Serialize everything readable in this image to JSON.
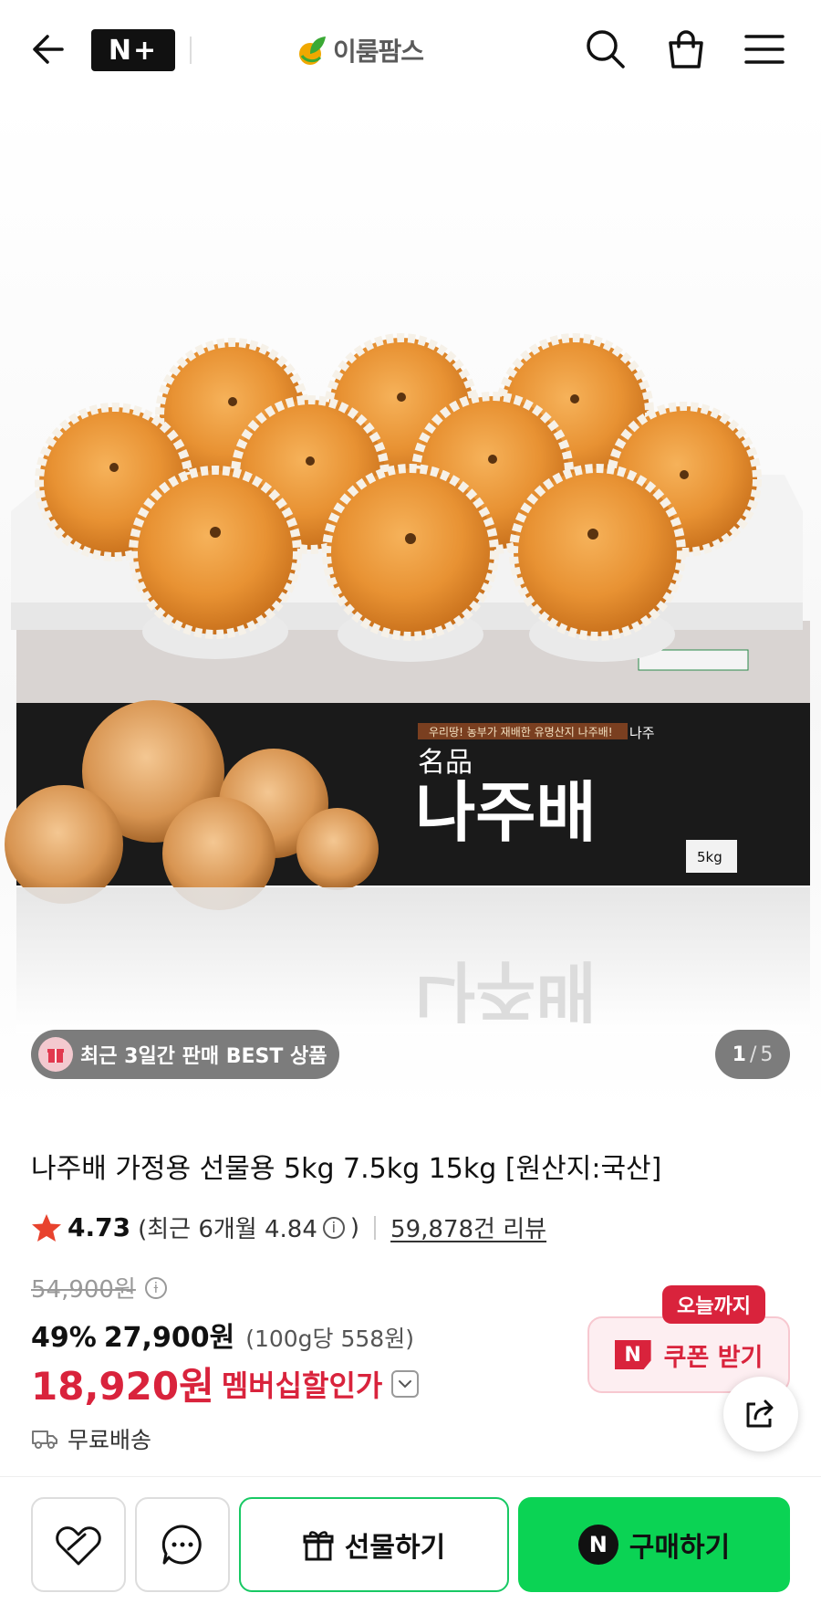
{
  "header": {
    "back_icon": "arrow-left-icon",
    "membership_logo": "N+",
    "store_name": "이룸팜스",
    "search_icon": "search-icon",
    "cart_icon": "shopping-bag-icon",
    "menu_icon": "hamburger-menu-icon"
  },
  "gallery": {
    "badge_label": "최근 3일간 판매 BEST 상품",
    "current_index": "1",
    "separator": "/",
    "total": "5",
    "box_text": {
      "banner": "우리땅! 농부가 재배한 유명산지 나주배!",
      "region": "나주",
      "hanja": "名品",
      "name": "나주배",
      "weight": "5kg"
    }
  },
  "product": {
    "title": "나주배 가정용 선물용 5kg 7.5kg 15kg [원산지:국산]",
    "rating": "4.73",
    "recent_rating_prefix": "(최근 6개월 4.84",
    "recent_rating_suffix": ")",
    "review_count": "59,878건 리뷰",
    "original_price": "54,900원",
    "discount_rate": "49%",
    "sale_price": "27,900원",
    "unit_price": "(100g당 558원)",
    "member_price": "18,920원",
    "member_label": "멤버십할인가",
    "shipping": "무료배송"
  },
  "coupon": {
    "badge": "오늘까지",
    "label": "쿠폰 받기",
    "brand_letter": "N"
  },
  "bottom_bar": {
    "gift_label": "선물하기",
    "buy_label": "구매하기",
    "buy_brand_letter": "N"
  },
  "colors": {
    "accent_red": "#d9233c",
    "naver_green": "#0bd354",
    "star": "#e8432e"
  }
}
